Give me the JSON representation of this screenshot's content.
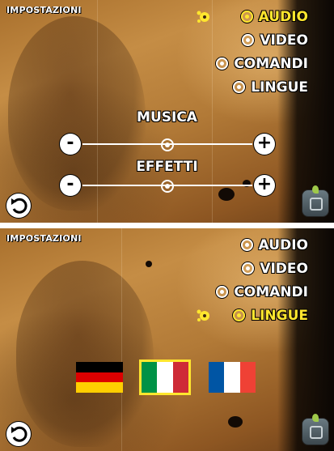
{
  "screens": [
    {
      "title": "IMPOSTAZIONI",
      "menu": [
        {
          "label": "AUDIO",
          "active": true
        },
        {
          "label": "VIDEO",
          "active": false
        },
        {
          "label": "COMANDI",
          "active": false
        },
        {
          "label": "LINGUE",
          "active": false
        }
      ],
      "sliders": [
        {
          "label": "MUSICA",
          "minus": "-",
          "plus": "+",
          "level": 0.5
        },
        {
          "label": "EFFETTI",
          "minus": "-",
          "plus": "+",
          "level": 0.5
        }
      ]
    },
    {
      "title": "IMPOSTAZIONI",
      "menu": [
        {
          "label": "AUDIO",
          "active": false
        },
        {
          "label": "VIDEO",
          "active": false
        },
        {
          "label": "COMANDI",
          "active": false
        },
        {
          "label": "LINGUE",
          "active": true
        }
      ],
      "flags": [
        {
          "language": "german",
          "colors": [
            "#000000",
            "#dd0000",
            "#ffce00"
          ],
          "orientation": "horizontal",
          "selected": false
        },
        {
          "language": "italian",
          "colors": [
            "#009246",
            "#ffffff",
            "#ce2b37"
          ],
          "orientation": "vertical",
          "selected": true
        },
        {
          "language": "french",
          "colors": [
            "#0055a4",
            "#ffffff",
            "#ef4135"
          ],
          "orientation": "vertical",
          "selected": false
        }
      ]
    }
  ],
  "theme": {
    "accent_active": "#ffe62e",
    "text": "#ffffff"
  }
}
